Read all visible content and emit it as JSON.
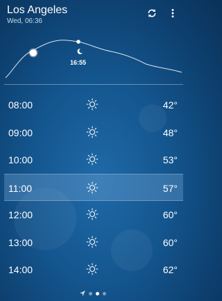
{
  "header": {
    "city": "Los Angeles",
    "date": "Wed, 06:36",
    "refresh_icon": "refresh-icon",
    "more_icon": "more-vert-icon"
  },
  "sun_chart": {
    "sunset_time": "16:55",
    "moon_icon": "crescent-moon-icon"
  },
  "hours": [
    {
      "time": "08:00",
      "icon": "sun-icon",
      "temp": "42°"
    },
    {
      "time": "09:00",
      "icon": "sun-icon",
      "temp": "48°"
    },
    {
      "time": "10:00",
      "icon": "sun-icon",
      "temp": "53°"
    },
    {
      "time": "11:00",
      "icon": "sun-icon",
      "temp": "57°",
      "selected": true
    },
    {
      "time": "12:00",
      "icon": "sun-icon",
      "temp": "60°"
    },
    {
      "time": "13:00",
      "icon": "sun-icon",
      "temp": "60°"
    },
    {
      "time": "14:00",
      "icon": "sun-icon",
      "temp": "62°"
    }
  ],
  "pager": {
    "pages": 3,
    "active": 1,
    "location_icon": "location-arrow-icon"
  }
}
